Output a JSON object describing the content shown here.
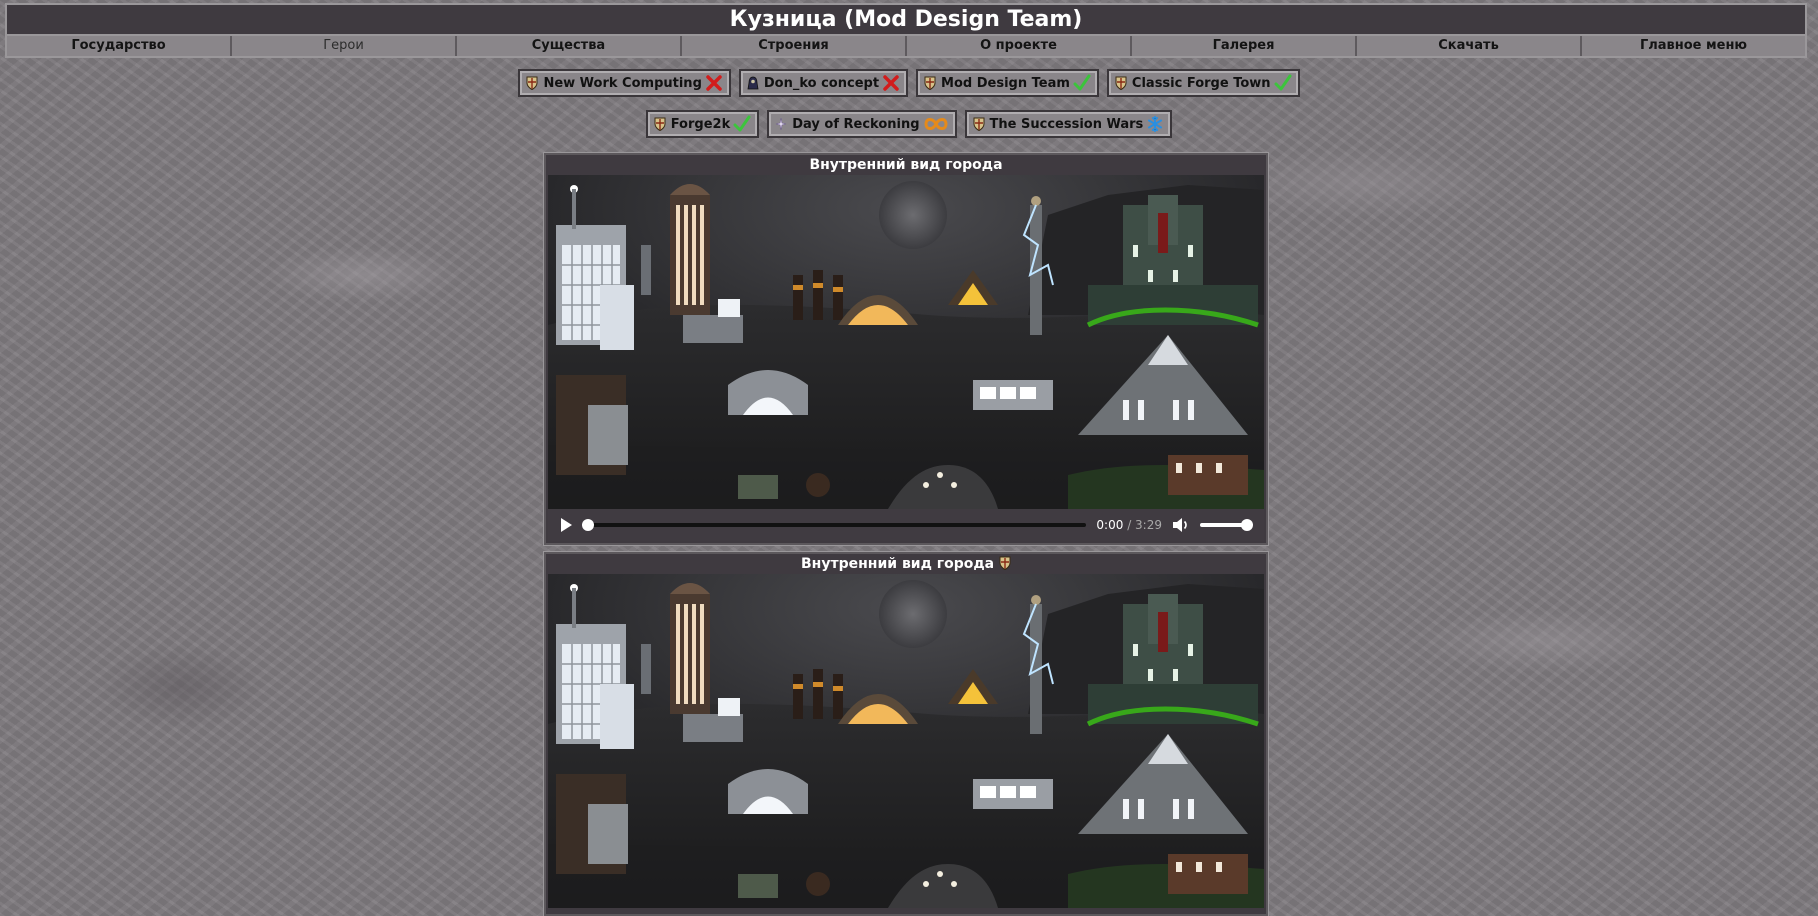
{
  "site": {
    "title": "Кузница (Mod Design Team)"
  },
  "nav": [
    {
      "label": "Государство"
    },
    {
      "label": "Герои"
    },
    {
      "label": "Существа"
    },
    {
      "label": "Строения"
    },
    {
      "label": "О проекте"
    },
    {
      "label": "Галерея"
    },
    {
      "label": "Скачать"
    },
    {
      "label": "Главное меню"
    }
  ],
  "mods_row1": [
    {
      "label": "New Work Computing",
      "status": "x-icon"
    },
    {
      "label": "Don_ko concept",
      "status": "x-icon"
    },
    {
      "label": "Mod Design Team",
      "status": "check-icon"
    },
    {
      "label": "Classic Forge Town",
      "status": "check-icon"
    }
  ],
  "mods_row2": [
    {
      "label": "Forge2k",
      "status": "check-icon"
    },
    {
      "label": "Day of Reckoning",
      "status": "infinity-icon"
    },
    {
      "label": "The Succession Wars",
      "status": "snowflake-icon"
    }
  ],
  "panels": [
    {
      "title": "Внутренний вид города"
    },
    {
      "title": "Внутренний вид города"
    }
  ],
  "video": {
    "current": "0:00",
    "separator": " / ",
    "duration": "3:29"
  },
  "colors": {
    "check": "#3cc43c",
    "x": "#d21c1c",
    "infinity": "#e58a1a",
    "snowflake": "#2a8fe0"
  }
}
